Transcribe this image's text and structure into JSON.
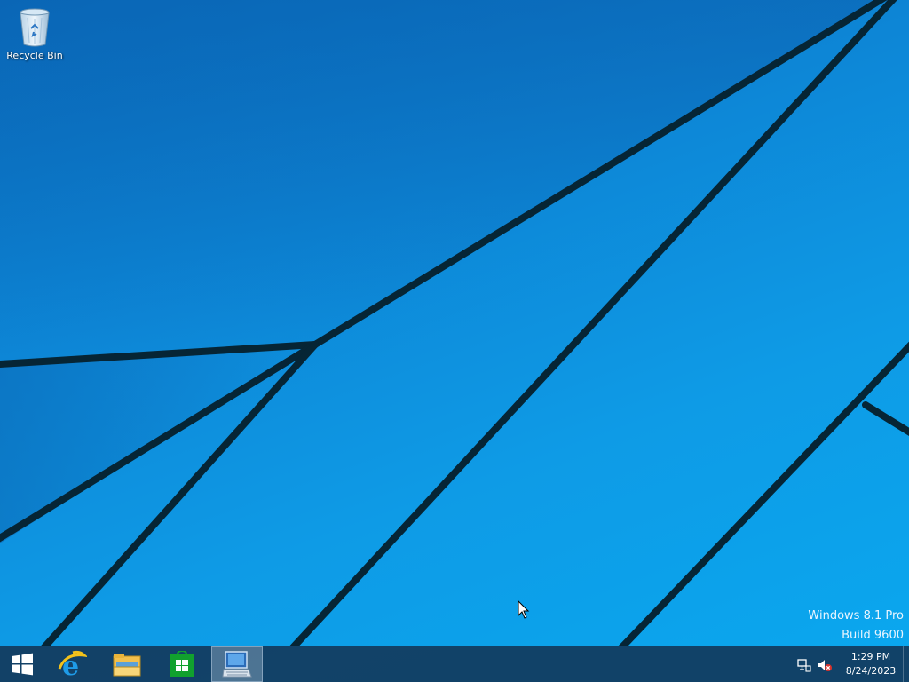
{
  "desktop": {
    "icons": [
      {
        "label": "Recycle Bin",
        "icon": "recycle-bin-icon"
      }
    ],
    "watermark": {
      "line1": "Windows 8.1 Pro",
      "line2": "Build 9600"
    }
  },
  "taskbar": {
    "start": {
      "icon": "windows-logo-icon"
    },
    "pinned": [
      {
        "name": "Internet Explorer",
        "icon": "internet-explorer-icon"
      },
      {
        "name": "File Explorer",
        "icon": "file-explorer-icon"
      },
      {
        "name": "Store",
        "icon": "store-icon"
      },
      {
        "name": "On-Screen Keyboard",
        "icon": "on-screen-keyboard-icon",
        "active": true
      }
    ],
    "tray": {
      "icons": [
        "network-icon",
        "volume-muted-icon"
      ],
      "time": "1:29 PM",
      "date": "8/24/2023"
    }
  },
  "colors": {
    "wallpaper_dark": "#0a6fc0",
    "wallpaper_light": "#0aa8ef",
    "taskbar": "#123a5c",
    "lines": "#06283a"
  }
}
